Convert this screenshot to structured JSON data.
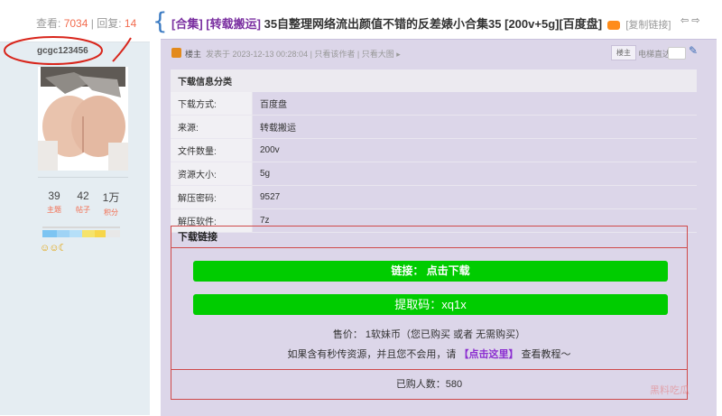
{
  "stats": {
    "views_label": "查看:",
    "views": "7034",
    "sep": "|",
    "replies_label": "回复:",
    "replies": "14"
  },
  "user": {
    "name": "gcgc123456",
    "topics": "39",
    "topics_label": "主题",
    "posts": "42",
    "posts_label": "帖子",
    "points": "1万",
    "points_label": "积分",
    "medals": "☺☺☾"
  },
  "thread": {
    "tag1": "[合集]",
    "tag2": "[转载搬运]",
    "title": "35自整理网络流出颜值不错的反差婊小合集35 [200v+5g][百度盘]",
    "copy_link": "[复制链接]",
    "nav": "⇦ ⇨"
  },
  "author_bar": {
    "owner": "楼主",
    "meta": "发表于 2023-12-13 00:28:04  |  只看该作者  |  只看大图 ▸",
    "badge": "楼主",
    "e_reader": "电梯直达"
  },
  "download_info": {
    "header": "下载信息分类",
    "rows": [
      {
        "k": "下载方式:",
        "v": "百度盘"
      },
      {
        "k": "来源:",
        "v": "转载搬运"
      },
      {
        "k": "文件数量:",
        "v": "200v"
      },
      {
        "k": "资源大小:",
        "v": "5g"
      },
      {
        "k": "解压密码:",
        "v": "9527"
      },
      {
        "k": "解压软件:",
        "v": "7z"
      }
    ]
  },
  "download_link": {
    "title": "下载链接",
    "btn_label": "链接：",
    "btn_action": "点击下载",
    "code_label": "提取码：xq1x",
    "price": "售价： 1软妹币（您已购买 或者 无需购买）",
    "instr_pre": "如果含有秒传资源，并且您不会用，请",
    "instr_link": "【点击这里】",
    "instr_post": "查看教程～",
    "buyers": "已购人数：580"
  },
  "watermark": "黑料吃瓜",
  "colors": {
    "green": "#00cc00",
    "red_border": "#cf4a4a",
    "post_bg": "#dcd6e9",
    "left_bg": "#e5edf2",
    "tag_purple": "#7a2fa0"
  }
}
